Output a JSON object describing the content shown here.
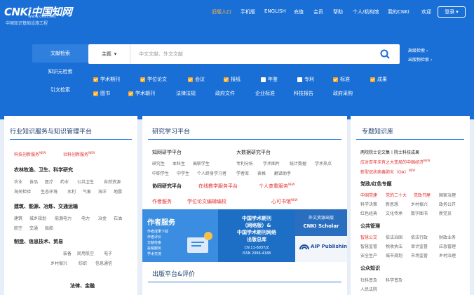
{
  "logo": {
    "mark": "CNKi中国知网",
    "url": "www.cnki.net",
    "subtitle": "中国知识基础设施工程"
  },
  "topnav": [
    "旧版入口",
    "手机版",
    "ENGLISH",
    "充值",
    "会员",
    "帮助",
    "个人/机构馆",
    "我的CNKI",
    "欢迎"
  ],
  "login_label": "登录",
  "tabs": [
    "文献检索",
    "知识元检索",
    "引文检索"
  ],
  "search": {
    "field": "主题",
    "placeholder": "中文文献、外文文献"
  },
  "side_links": [
    "高级检索",
    "出版物检索"
  ],
  "db_row1": [
    "学术期刊",
    "学位论文",
    "会议",
    "报纸",
    "年鉴",
    "专利",
    "标准",
    "成果"
  ],
  "db_row2": [
    "图书",
    "学术辑刊"
  ],
  "db_row2_plain": [
    "法律法规",
    "政府文件",
    "企业标准",
    "科技报告",
    "政府采购"
  ],
  "left_panel": {
    "title": "行业知识服务与知识管理平台",
    "links": [
      "科技创新服务",
      "社科创新服务"
    ],
    "g1_title": "农林牧渔、卫生、科学研究",
    "g1_items": [
      "农业",
      "食品",
      "医疗",
      "药业",
      "公共卫生",
      "自然资源",
      "海关检验",
      "生态环境",
      "水利",
      "气象",
      "海洋",
      "地震"
    ],
    "g2_title": "建筑、能源、冶炼、交通运输",
    "g2_items": [
      "建筑",
      "城乡规划",
      "能源电力",
      "电力",
      "冶金",
      "石油",
      "航空",
      "交通",
      "船舶"
    ],
    "g3_title": "制造、信息技术、贸易",
    "g3_items": [
      "装备",
      "民用航空",
      "电子",
      "乡村振兴",
      "纺织",
      "信息通信"
    ],
    "g4_title": "法律、金融"
  },
  "mid_panel": {
    "title": "研究学习平台",
    "sub1": "知网研学平台",
    "sub1_items": [
      "研究生",
      "本科生",
      "高职学生",
      "中职学生",
      "中学生",
      "个人终身学习者"
    ],
    "sub2": "大数据研究平台",
    "sub2_items": [
      "专利分析",
      "学术图片",
      "统计数据",
      "学术热点",
      "学者库",
      "表格",
      "翻译助手"
    ],
    "sub3": "协同研究平台",
    "red_links": [
      "在线教学服务平台",
      "个人查重服务",
      "作者服务",
      "学位论文编辑编校",
      "心可书馆"
    ],
    "banner": {
      "left_title": "作者服务",
      "left_items": [
        "作者成果下载",
        "作者评价",
        "文献检索",
        "投稿服务",
        "学术交流"
      ],
      "mid_lines": [
        "中国学术期刊",
        "（网络版）&",
        "中国学术期刊网络",
        "出版总库"
      ],
      "cn": "CN 11-6037/Z",
      "issn": "ISSN 2096-4188",
      "right_top": "外文资源出版",
      "right_sub": "CNKI Scholar",
      "right_bottom": "AIP Publishing"
    },
    "sub4": "出版平台&评价"
  },
  "right_panel": {
    "title": "专题知识库",
    "links": [
      "两院院士论文集丨院士科技成果",
      "应对百年未有之大变局的中国经济",
      "新型冠状病毒肺炎（OA）"
    ],
    "g1": "党政/红色专题",
    "g1_items": [
      "中国党建",
      "党的二十大",
      "党政书屋",
      "国家治理",
      "科学决策",
      "新思想",
      "乡村振兴",
      "政务公开",
      "红色经典",
      "文化传承",
      "数字图书",
      "新党员"
    ],
    "g2": "公共管理",
    "g2_items": [
      "智慧公交",
      "依法治国",
      "依法行政",
      "财政业务",
      "智慧监管",
      "税收执法",
      "审计监督",
      "应急管理",
      "安全生产",
      "城市规划",
      "市场监管",
      "乡村治理"
    ],
    "g3": "公众知识",
    "g3_items": [
      "社科普及",
      "科学普及",
      "人民法院"
    ]
  }
}
